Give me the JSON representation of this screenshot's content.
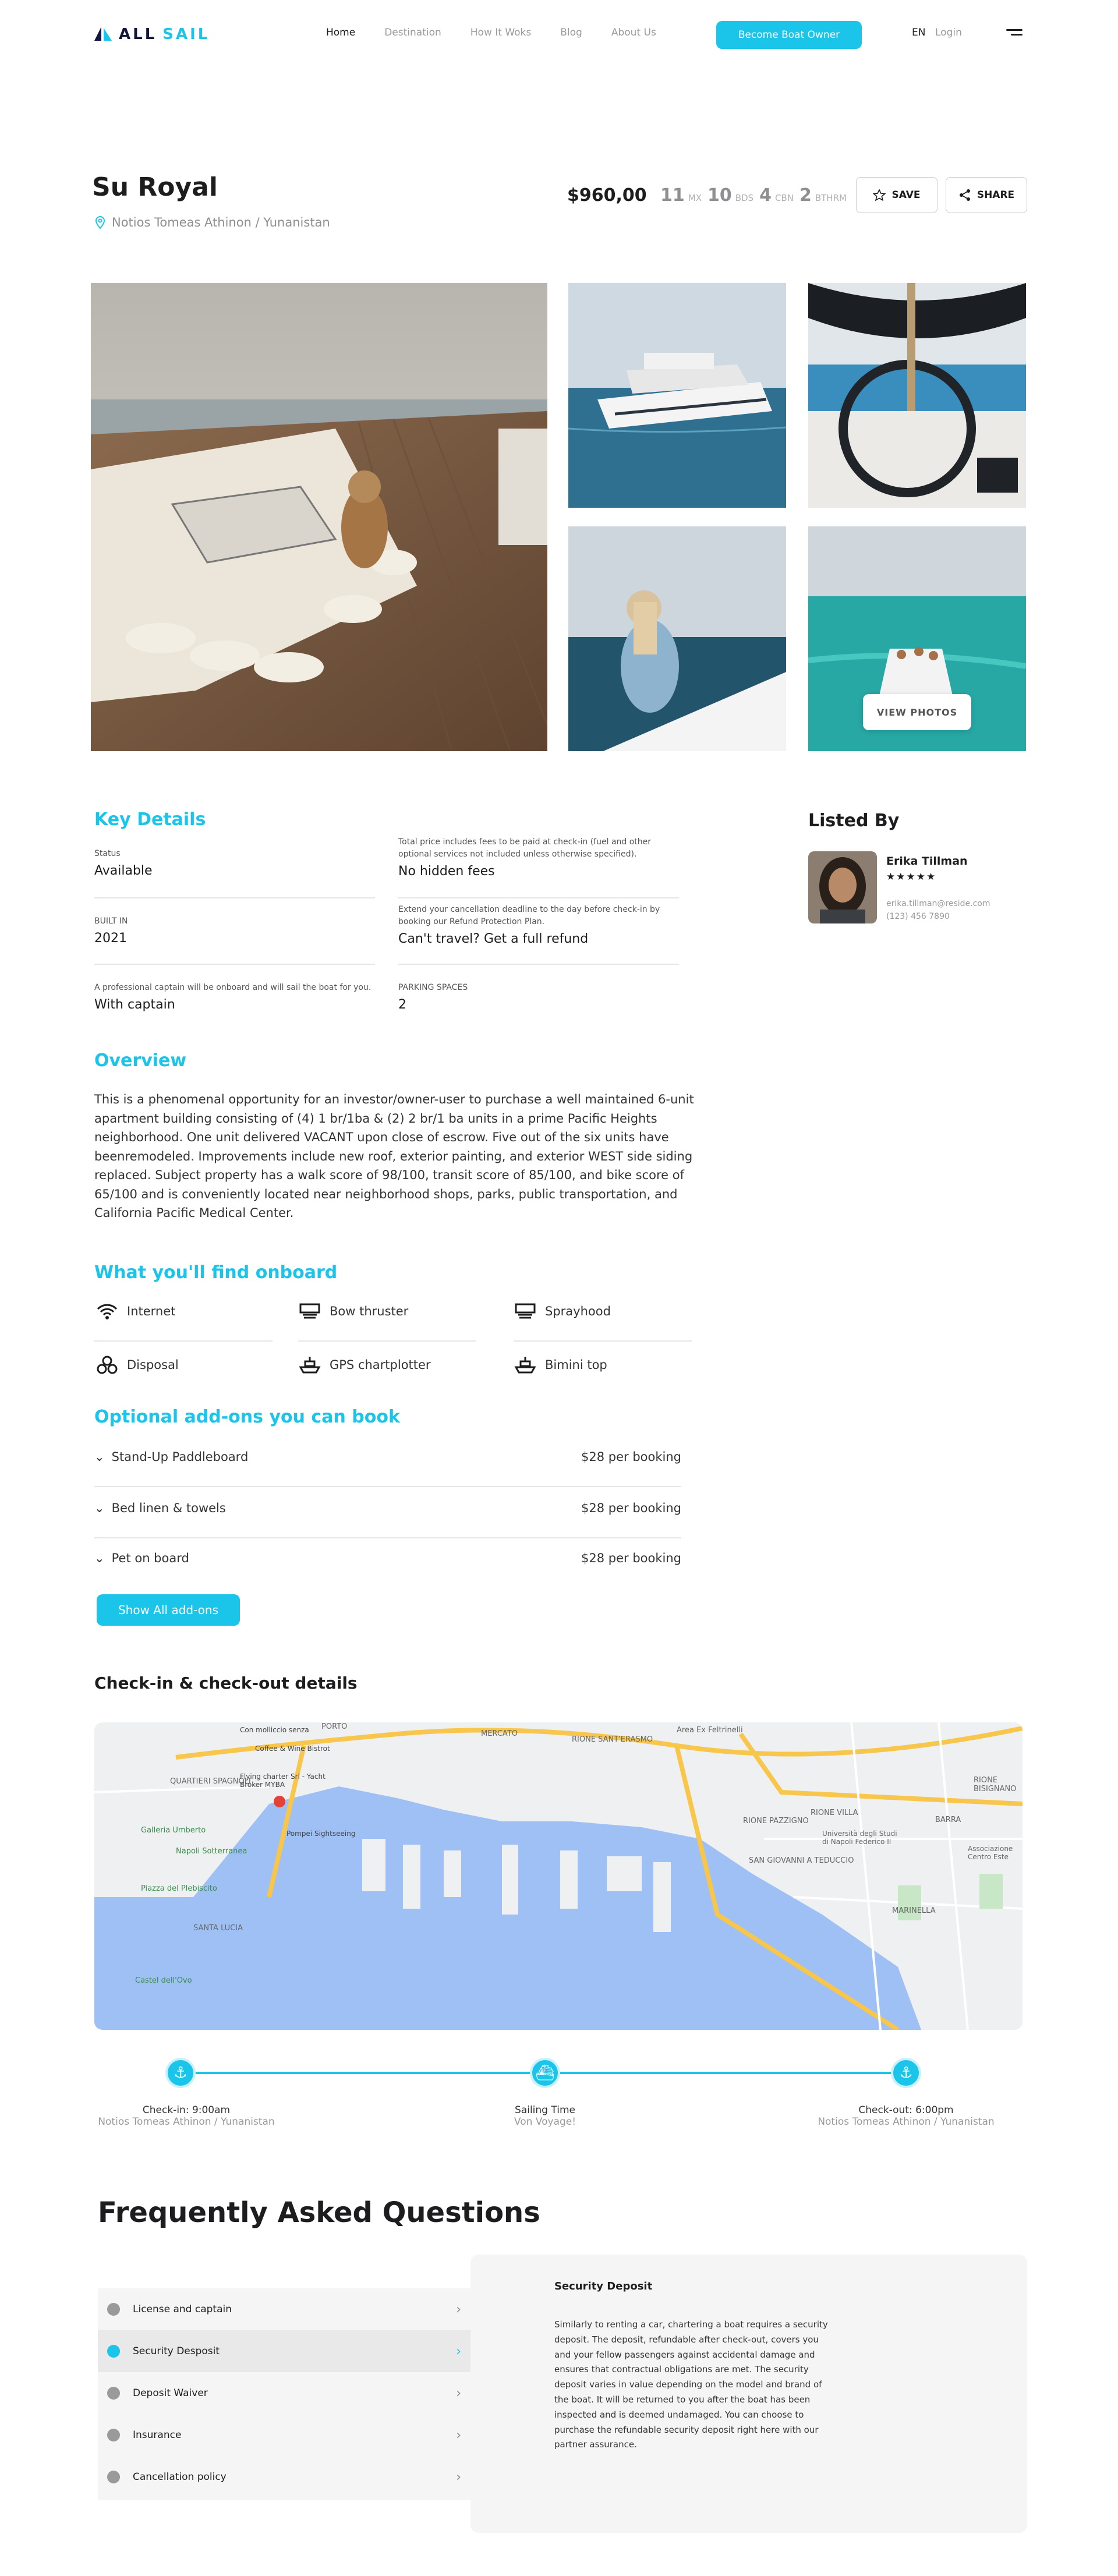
{
  "brand": {
    "part1": "ALL",
    "part2": "SAIL"
  },
  "nav": {
    "items": [
      "Home",
      "Destination",
      "How It Woks",
      "Blog",
      "About Us"
    ],
    "cta": "Become Boat Owner",
    "lang": "EN",
    "login": "Login"
  },
  "listing": {
    "title": "Su Royal",
    "location": "Notios Tomeas Athinon / Yunanistan",
    "price": "$960,00",
    "specs": [
      {
        "n": "11",
        "u": "MX"
      },
      {
        "n": "10",
        "u": "BDS"
      },
      {
        "n": "4",
        "u": "CBN"
      },
      {
        "n": "2",
        "u": "BTHRM"
      }
    ],
    "save": "SAVE",
    "share": "SHARE",
    "view_photos": "VIEW PHOTOS"
  },
  "key_details": {
    "heading": "Key Details",
    "items": [
      {
        "label": "Status",
        "value": "Available"
      },
      {
        "label": "Total price includes fees to be paid at check-in (fuel and other optional services not included unless otherwise specified).",
        "value": "No hidden fees"
      },
      {
        "label": "BUILT IN",
        "value": "2021"
      },
      {
        "label": "Extend your cancellation deadline to the day before check-in by booking our Refund Protection Plan.",
        "value": "Can't travel? Get a full refund"
      },
      {
        "label": "A professional captain will be onboard and will sail the boat for you.",
        "value": "With captain"
      },
      {
        "label": "PARKING SPACES",
        "value": "2"
      }
    ]
  },
  "listed_by": {
    "heading": "Listed By",
    "name": "Erika Tillman",
    "stars": "★★★★★",
    "email": "erika.tillman@reside.com",
    "phone": "(123) 456 7890"
  },
  "overview": {
    "heading": "Overview",
    "text": "This is a phenomenal opportunity for an investor/owner-user to purchase a well maintained 6-unit apartment building consisting of (4) 1 br/1ba & (2) 2 br/1 ba units in a prime Pacific Heights neighborhood. One unit delivered VACANT upon close of escrow. Five out of the six units have beenremodeled. Improvements include new roof, exterior painting, and exterior WEST side siding replaced. Subject property has a walk score of 98/100, transit score of 85/100, and bike score of 65/100 and is conveniently located near neighborhood shops, parks, public transportation, and California Pacific Medical Center."
  },
  "onboard": {
    "heading": "What you'll find onboard",
    "items": [
      "Internet",
      "Bow thruster",
      "Sprayhood",
      "Disposal",
      "GPS chartplotter",
      "Bimini top"
    ]
  },
  "addons": {
    "heading": "Optional add-ons you can book",
    "items": [
      {
        "name": "Stand-Up Paddleboard",
        "price": "$28 per booking"
      },
      {
        "name": "Bed linen & towels",
        "price": "$28 per booking"
      },
      {
        "name": "Pet on board",
        "price": "$28 per booking"
      }
    ],
    "button": "Show All add-ons"
  },
  "checkin": {
    "heading": "Check-in & check-out details",
    "map_labels": [
      "PORTO",
      "MERCATO",
      "RIONE SANT'ERASMO",
      "Area Ex Feltrinelli",
      "RIONE BISIGNANO",
      "QUARTIERI SPAGNOLI",
      "RIONE VILLA",
      "BARRA",
      "RIONE PAZZIGNO",
      "SAN GIOVANNI A TEDUCCIO",
      "MARINELLA",
      "SANTA LUCIA",
      "Castel dell'Ovo",
      "Piazza del Plebiscito",
      "Galleria Umberto",
      "Napoli Sotterranea",
      "Flying charter Srl - Yacht Broker MYBA",
      "Con molliccio senza",
      "Coffee & Wine Bistrot",
      "Università degli Studi di Napoli Federico II",
      "Associazione Centro Este",
      "Pompei Sightseeing"
    ],
    "steps": [
      {
        "label": "Check-in: 9:00am",
        "sub": "Notios Tomeas Athinon / Yunanistan"
      },
      {
        "label": "Sailing Time",
        "sub": "Von Voyage!"
      },
      {
        "label": "Check-out: 6:00pm",
        "sub": "Notios Tomeas Athinon / Yunanistan"
      }
    ]
  },
  "faq": {
    "heading": "Frequently Asked Questions",
    "items": [
      "License and captain",
      "Security Desposit",
      "Deposit Waiver",
      "Insurance",
      "Cancellation policy"
    ],
    "selected_title": "Security Deposit",
    "selected_text": "Similarly to renting a car, chartering a boat requires a security deposit. The deposit, refundable after check-out, covers you and your fellow passengers against accidental damage and ensures that contractual obligations are met. The security deposit varies in value depending on the model and brand of the boat. It will be returned to you after the boat has been inspected and is deemed undamaged. You can choose to purchase the refundable security deposit right here with our partner assurance."
  },
  "colors": {
    "accent": "#1bc4e9",
    "text": "#1d1d1f",
    "muted": "#8e8e93"
  }
}
